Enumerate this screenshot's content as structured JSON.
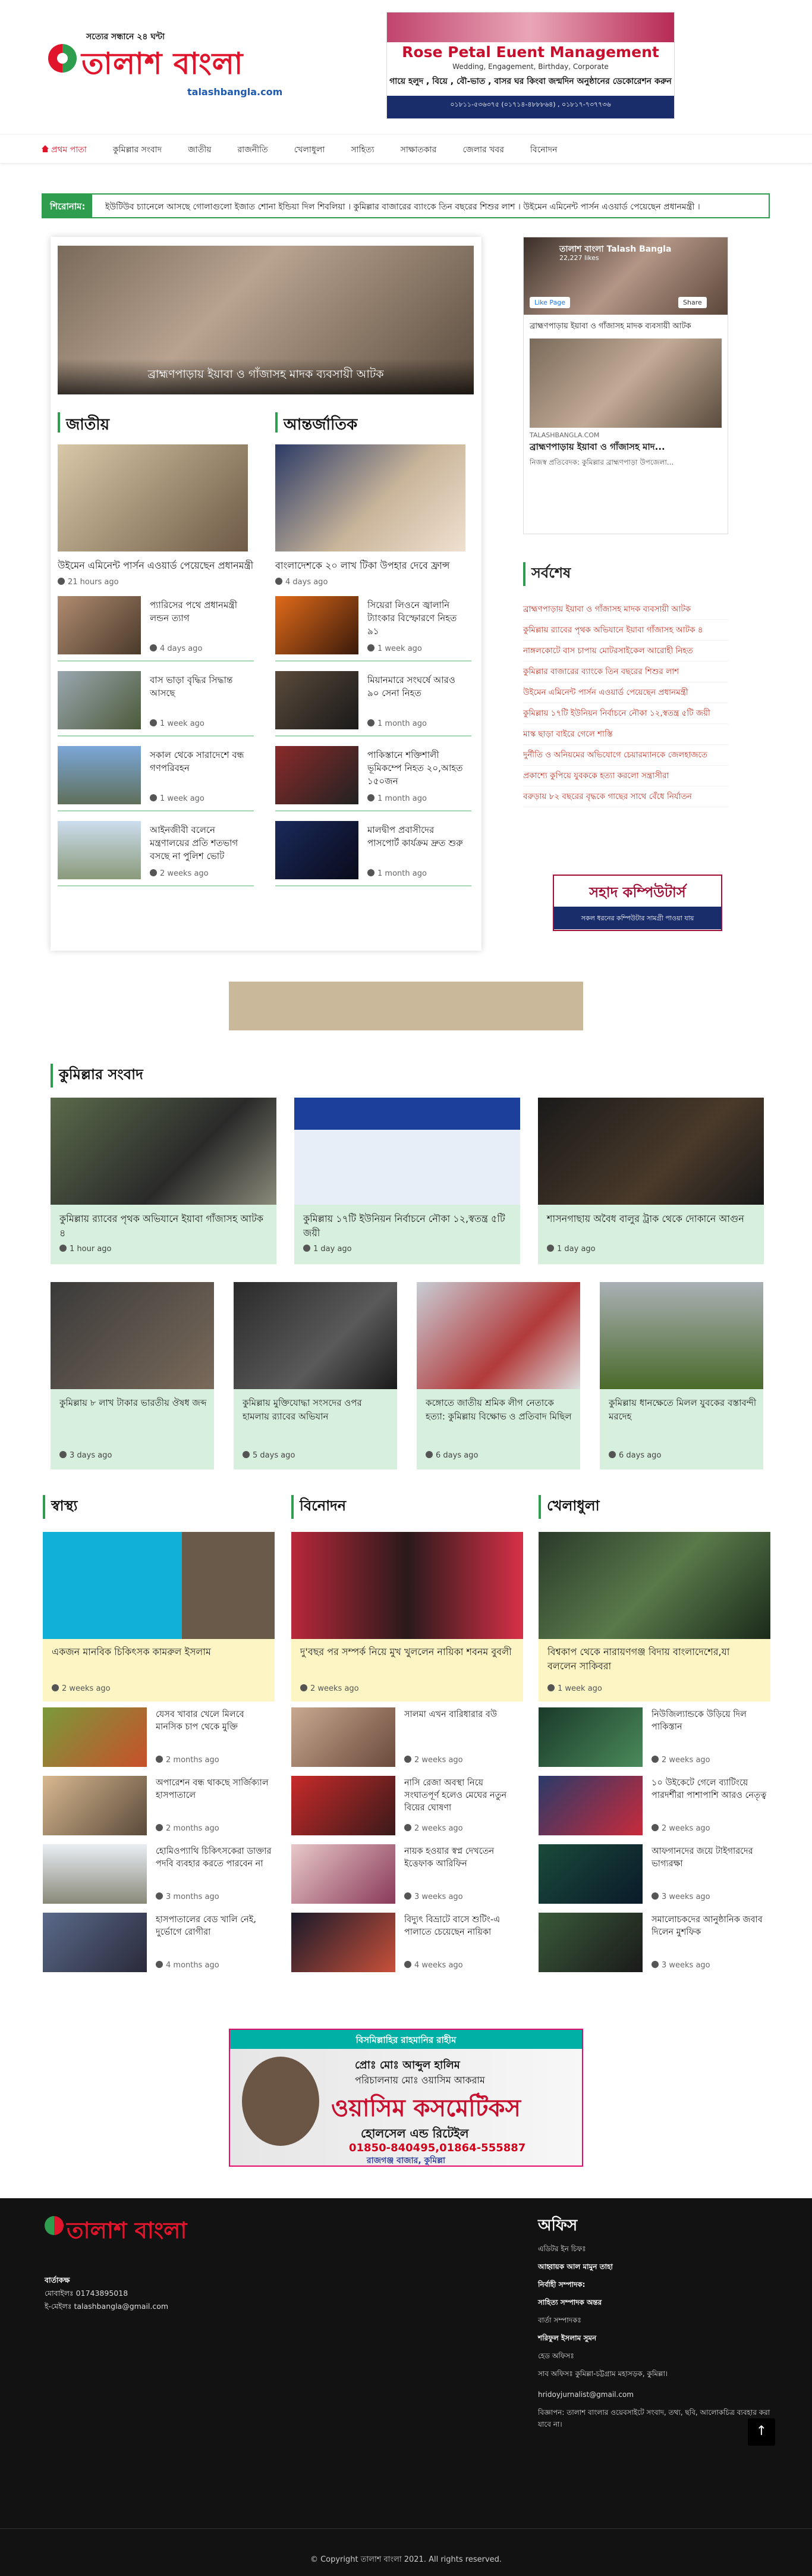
{
  "header": {
    "tagline": "সত্যের সন্ধানে ২৪ ঘন্টা",
    "logo_text": "তালাশ বাংলা",
    "url": "talashbangla.com"
  },
  "ad_top": {
    "title": "Rose Petal Euent Management",
    "sub": "Wedding, Engagement, Birthday, Corporate",
    "line": "গায়ে হলুদ , বিয়ে , বৌ-ভাত , বাসর ঘর কিংবা জন্মদিন অনুষ্ঠানের ডেকোরেশন করুন",
    "contact": "০১৮১১-৫৩৬৩৭৫ (০১৭১৪-৪৮৮৮৬৪) , ০১৮১৭-৭৩৭৭৩৬"
  },
  "nav": {
    "items": [
      "প্রথম পাতা",
      "কুমিল্লার সংবাদ",
      "জাতীয়",
      "রাজনীতি",
      "খেলাধুলা",
      "সাহিত্য",
      "সাক্ষাতকার",
      "জেলার খবর",
      "বিনোদন"
    ]
  },
  "ticker": {
    "label": "শিরোনাম:",
    "text": "ইউটিউব চ্যানেলে আসছে গোলাগুলো ইজাত শোনা ইন্ডিয়া দিল শিবলিয়া । কুমিল্লার বাজারের ব্যাংকে তিন বছরের শিশুর লাশ । উইমেন এমিনেন্ট পার্সন এওয়ার্ড পেয়েছেন প্রধানমন্ত্রী ।"
  },
  "hero": {
    "caption": "ব্রাহ্মণপাড়ায় ইয়াবা ও গাঁজাসহ মাদক ব্যবসায়ী আটক"
  },
  "jatiyo": {
    "heading": "জাতীয়",
    "lead_title": "উইমেন এমিনেন্ট পার্সন এওয়ার্ড পেয়েছেন প্রধানমন্ত্রী",
    "lead_time": "21 hours ago",
    "items": [
      {
        "title": "প্যারিসের পথে প্রধানমন্ত্রী লন্ডন ত্যাগ",
        "time": "4 days ago"
      },
      {
        "title": "বাস ভাড়া বৃদ্ধির সিদ্ধান্ত আসছে",
        "time": "1 week ago"
      },
      {
        "title": "সকাল থেকে সারাদেশে বন্ধ গণপরিবহন",
        "time": "1 week ago"
      },
      {
        "title": "আইনজীবী বলেনে মন্ত্রণালয়ের প্রতি শতভাগ বসছে না পুলিশ ভোট",
        "time": "2 weeks ago"
      }
    ]
  },
  "antorjatik": {
    "heading": "আন্তর্জাতিক",
    "lead_title": "বাংলাদেশকে ২০ লাখ টিকা উপহার দেবে ফ্রান্স",
    "lead_time": "4 days ago",
    "items": [
      {
        "title": "সিয়েরা লিওনে জ্বালানি ট্যাংকার বিস্ফোরণে নিহত ৯১",
        "time": "1 week ago"
      },
      {
        "title": "মিয়ানমারে সংঘর্ষে আরও ৯০ সেনা নিহত",
        "time": "1 month ago"
      },
      {
        "title": "পাকিস্তানে শক্তিশালী ভূমিকম্পে নিহত ২০,আহত ১৫০জন",
        "time": "1 month ago"
      },
      {
        "title": "মালদ্বীপ প্রবাসীদের পাসপোর্ট কার্যক্রম দ্রুত শুরু",
        "time": "1 month ago"
      }
    ]
  },
  "fb": {
    "page": "তালাশ বাংলা Talash Bangla",
    "followers": "22,227 likes",
    "like": "Like Page",
    "share": "Share",
    "post": "ব্রাহ্মণপাড়ায় ইয়াবা ও গাঁজাসহ মাদক ব্যবসায়ী আটক",
    "src": "TALASHBANGLA.COM",
    "post_title": "ব্রাহ্মণপাড়ায় ইয়াবা ও গাঁজাসহ মাদ...",
    "post_desc": "নিজস্ব প্রতিবেদক: কুমিল্লার ব্রাহ্মণপাড়া উপজেলা..."
  },
  "latest": {
    "heading": "সর্বশেষ",
    "items": [
      "ব্রাহ্মণপাড়ায় ইয়াবা ও গাঁজাসহ মাদক ব্যবসায়ী আটক",
      "কুমিল্লায় র‍্যাবের পৃথক অভিযানে ইয়াবা গাঁজাসহ আটক ৪",
      "নাঙ্গলকোটে বাস চাপায় মোটরসাইকেল আরোহী নিহত",
      "কুমিল্লার বাজারের ব্যাংকে তিন বছরের শিশুর লাশ",
      "উইমেন এমিনেন্ট পার্সন এওয়ার্ড পেয়েছেন প্রধানমন্ত্রী",
      "কুমিল্লায় ১৭টি ইউনিয়ন নির্বাচনে নৌকা ১২,স্বতন্ত্র ৫টি জয়ী",
      "মাস্ক ছাড়া বাইরে গেলে শাস্তি",
      "দুর্নীতি ও অনিয়মের অভিযোগে চেয়ারম্যানকে জেলহাজতে",
      "প্রকাশ্যে কুপিয়ে যুবককে হত্যা করলো সন্ত্রাসীরা",
      "বরুড়ায় ৮২ বছরের বৃদ্ধকে গাছের সাথে বেঁধে নির্যাতন"
    ]
  },
  "ad_side": {
    "title": "সহাদ কম্পিউটার্স",
    "bar": "সকল ধরনের কম্পিউটার সামগ্রী পাওয়া যায়"
  },
  "comilla": {
    "heading": "কুমিল্লার সংবাদ",
    "row1": [
      {
        "title": "কুমিল্লায় র‍্যাবের পৃথক অভিযানে ইয়াবা গাঁজাসহ আটক ৪",
        "time": "1 hour ago"
      },
      {
        "title": "কুমিল্লায় ১৭টি ইউনিয়ন নির্বাচনে নৌকা ১২,স্বতন্ত্র ৫টি জয়ী",
        "time": "1 day ago"
      },
      {
        "title": "শাসনগাছায় অবৈধ বালুর ট্রাক থেকে দোকানে আগুন",
        "time": "1 day ago"
      }
    ],
    "row2": [
      {
        "title": "কুমিল্লায় ৮ লাখ টাকার ভারতীয় ঔষধ জব্দ",
        "time": "3 days ago"
      },
      {
        "title": "কুমিল্লায় মুক্তিযোদ্ধা সংসদের ওপর হামলায় র‍্যাবের অভিযান",
        "time": "5 days ago"
      },
      {
        "title": "কঙ্গোতে জাতীয় শ্রমিক লীগ নেতাকে হত্যা: কুমিল্লায় বিক্ষোভ ও প্রতিবাদ মিছিল",
        "time": "6 days ago"
      },
      {
        "title": "কুমিল্লায় ধানক্ষেতে মিলল যুবকের বস্তাবন্দী মরদেহ",
        "time": "6 days ago"
      }
    ]
  },
  "health": {
    "heading": "স্বাস্থ্য",
    "lead_title": "একজন মানবিক চিকিৎসক কামরুল ইসলাম",
    "lead_time": "2 weeks ago",
    "items": [
      {
        "title": "যেসব খাবার খেলে মিলবে মানসিক চাপ থেকে মুক্তি",
        "time": "2 months ago"
      },
      {
        "title": "অপারেশন বন্ধ থাকছে সার্জিক্যাল হাসপাতালে",
        "time": "2 months ago"
      },
      {
        "title": "হোমিওপ্যাথি চিকিৎসকেরা ডাক্তার পদবি ব্যবহার করতে পারবেন না",
        "time": "3 months ago"
      },
      {
        "title": "হাসপাতালের বেড খালি নেই, দুর্ভোগে রোগীরা",
        "time": "4 months ago"
      }
    ]
  },
  "entertainment": {
    "heading": "বিনোদন",
    "lead_title": "দু'বছর পর সম্পর্ক নিয়ে মুখ খুললেন নায়িকা শবনম বুবলী",
    "lead_time": "2 weeks ago",
    "items": [
      {
        "title": "সালমা এখন বারিধারার বউ",
        "time": "2 weeks ago"
      },
      {
        "title": "নাসি রেজা অবস্থা নিয়ে সংঘাতপূর্ণ হলেও মেঘের নতুন বিয়ের ঘোষণা",
        "time": "2 weeks ago"
      },
      {
        "title": "নায়ক হওয়ার স্বপ্ন দেখতেন ইত্তেফাক আরিফিন",
        "time": "3 weeks ago"
      },
      {
        "title": "বিদ্যুৎ বিভ্রাটে বাসে শুটিং-এ পালাতে চেয়েছেন নায়িকা",
        "time": "4 weeks ago"
      }
    ]
  },
  "sports": {
    "heading": "খেলাধুলা",
    "lead_title": "বিশ্বকাপ থেকে নারায়ণগঞ্জ বিদায় বাংলাদেশের,যা বললেন সাকিবরা",
    "lead_time": "1 week ago",
    "items": [
      {
        "title": "নিউজিল্যান্ডকে উড়িয়ে দিল পাকিস্তান",
        "time": "2 weeks ago"
      },
      {
        "title": "১০ উইকেটে গেলে ব্যাটিংয়ে পারদর্শীরা পাশাপাশি আরও নেতৃত্ব",
        "time": "2 weeks ago"
      },
      {
        "title": "আফগানদের জয়ে টাইগারদের ভাগ্যরক্ষা",
        "time": "3 weeks ago"
      },
      {
        "title": "সমালোচকদের আনুষ্ঠানিক জবাব দিলেন মুশফিক",
        "time": "3 weeks ago"
      }
    ]
  },
  "ad_bottom": {
    "top": "বিসমিল্লাহির রাহমানির রাহীম",
    "owner": "প্রোঃ মোঃ আব্দুল হালিম",
    "manager": "পরিচালনায় মোঃ ওয়াসিম আকরাম",
    "name": "ওয়াসিম কসমেটিকস",
    "sub": "হোলসেল এন্ড রিটেইল",
    "phone": "01850-840495,01864-555887",
    "addr": "রাজগঞ্জ বাজার, কুমিল্লা"
  },
  "footer": {
    "logo_text": "তালাশ বাংলা",
    "left_label": "বার্তাকক্ষ",
    "mobile": "মোবাইলঃ 01743895018",
    "email": "ই-মেইলঃ talashbangla@gmail.com",
    "office_heading": "অফিস",
    "lines": [
      "এডিটর ইন চিফঃ",
      "আহ্বায়ক আল মামুন তাহা",
      "নির্বাহী সম্পাদক:",
      "সাহিত্য সম্পাদক অন্তর",
      "বার্তা সম্পাদকঃ",
      "শরিফুল ইসলাম সুমন",
      "হেড অফিসঃ",
      "সাব অফিসঃ কুমিল্লা-চট্টগ্রাম মহাসড়ক, কুমিল্লা।",
      "hridoyjurnalist@gmail.com",
      "বিজ্ঞাপন: তালাশ বাংলার ওয়েবসাইটে সংবাদ, তথ্য, ছবি, আলোকচিত্র ব্যবহার করা যাবে না।"
    ],
    "copyright": "© Copyright তালাশ বাংলা 2021. All rights reserved."
  }
}
